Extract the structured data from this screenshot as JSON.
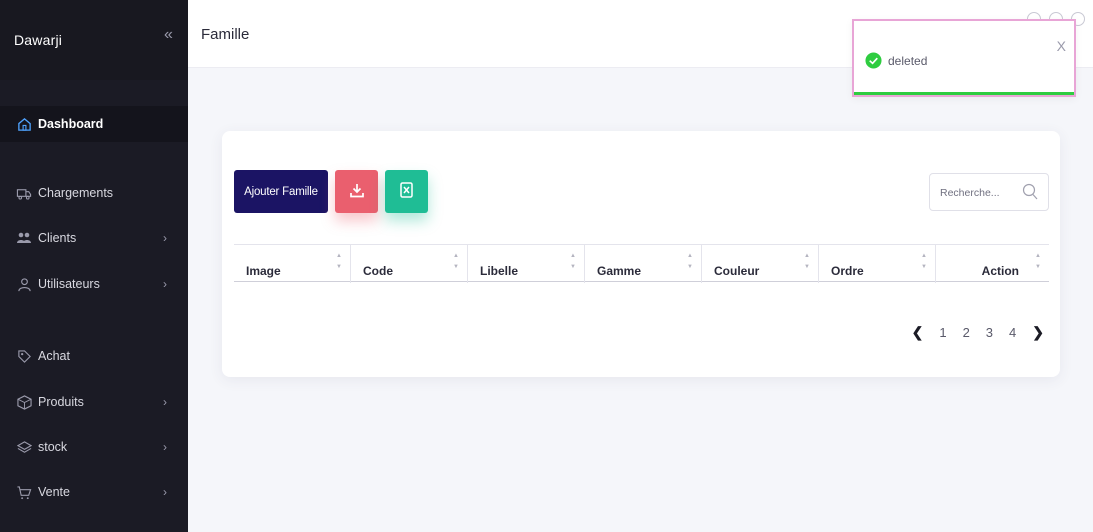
{
  "sidebar": {
    "brand": "Dawarji",
    "collapse_glyph": "«",
    "items": [
      {
        "label": "Dashboard",
        "icon": "home-icon",
        "active": true,
        "has_chevron": false
      },
      {
        "label": "Chargements",
        "icon": "truck-icon",
        "active": false,
        "has_chevron": false
      },
      {
        "label": "Clients",
        "icon": "users-icon",
        "active": false,
        "has_chevron": true
      },
      {
        "label": "Utilisateurs",
        "icon": "user-icon",
        "active": false,
        "has_chevron": true
      },
      {
        "label": "Achat",
        "icon": "tag-icon",
        "active": false,
        "has_chevron": false
      },
      {
        "label": "Produits",
        "icon": "box-icon",
        "active": false,
        "has_chevron": true
      },
      {
        "label": "stock",
        "icon": "layers-icon",
        "active": false,
        "has_chevron": true
      },
      {
        "label": "Vente",
        "icon": "cart-icon",
        "active": false,
        "has_chevron": true
      }
    ],
    "chevron_glyph": "›"
  },
  "header": {
    "title": "Famille"
  },
  "toolbar": {
    "add_label": "Ajouter Famille",
    "search_placeholder": "Recherche..."
  },
  "table": {
    "columns": [
      "Image",
      "Code",
      "Libelle",
      "Gamme",
      "Couleur",
      "Ordre",
      "Action"
    ]
  },
  "pagination": {
    "prev": "❮",
    "next": "❯",
    "pages": [
      "1",
      "2",
      "3",
      "4"
    ]
  },
  "toast": {
    "message": "deleted",
    "close": "X"
  },
  "colors": {
    "sidebar_bg": "#1b1b25",
    "primary": "#1b1464",
    "danger": "#ea5f6e",
    "success": "#1fbd95",
    "toast_ok": "#2ecc40"
  }
}
